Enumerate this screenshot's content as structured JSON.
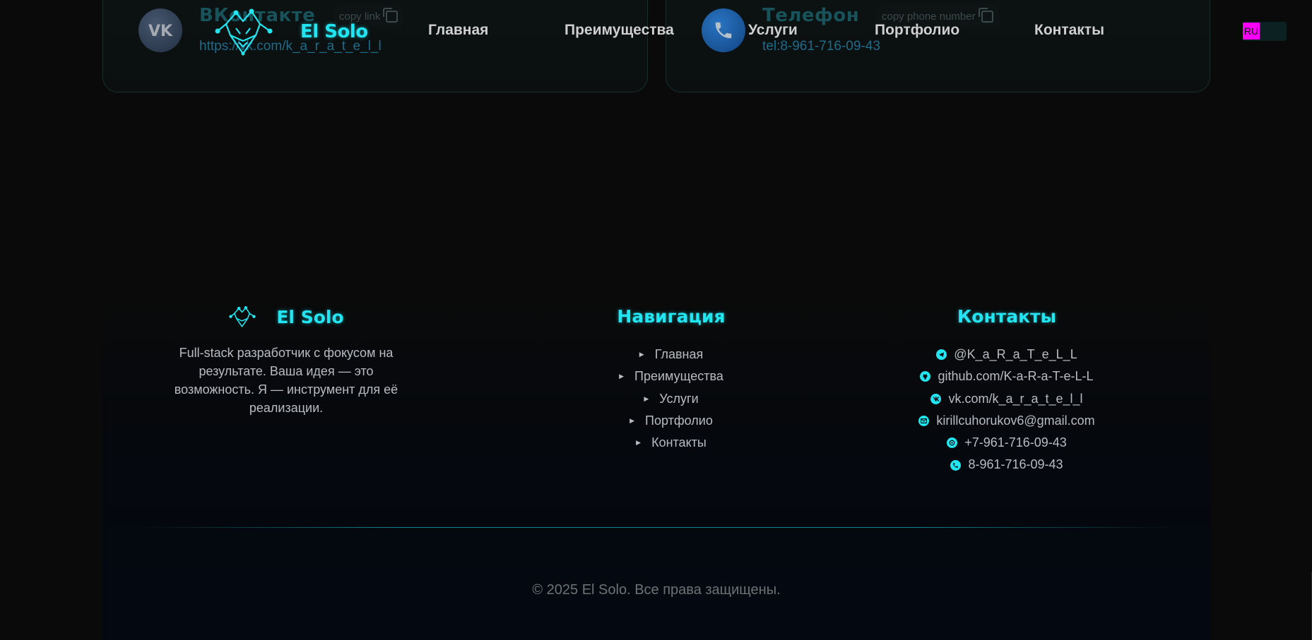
{
  "cards": [
    {
      "title": "ВКонтакте",
      "link": "https://vk.com/k_a_r_a_t_e_l_l",
      "copy_label": "copy link",
      "icon": "vk-icon"
    },
    {
      "title": "Телефон",
      "link": "tel:8-961-716-09-43",
      "copy_label": "copy phone number",
      "icon": "phone-icon"
    }
  ],
  "header": {
    "brand": "El Solo",
    "nav": [
      "Главная",
      "Преимущества",
      "Услуги",
      "Портфолио",
      "Контакты"
    ],
    "language": "RU"
  },
  "footer": {
    "brand": "El Solo",
    "description": "Full-stack разработчик с фокусом на результате. Ваша идея — это возможность. Я — инструмент для её реализации.",
    "nav_heading": "Навигация",
    "nav": [
      "Главная",
      "Преимущества",
      "Услуги",
      "Портфолио",
      "Контакты"
    ],
    "contacts_heading": "Контакты",
    "contacts": [
      {
        "icon": "telegram-icon",
        "text": "@K_a_R_a_T_e_L_L"
      },
      {
        "icon": "github-icon",
        "text": "github.com/K-a-R-a-T-e-L-L"
      },
      {
        "icon": "vk-icon",
        "text": "vk.com/k_a_r_a_t_e_l_l"
      },
      {
        "icon": "email-icon",
        "text": "kirillcuhorukov6@gmail.com"
      },
      {
        "icon": "whatsapp-icon",
        "text": "+7-961-716-09-43"
      },
      {
        "icon": "phone-icon",
        "text": "8-961-716-09-43"
      }
    ],
    "copyright": "© 2025 El Solo. Все права защищены."
  },
  "colors": {
    "accent": "#21e6f2",
    "background": "#0a0a0a",
    "language_flag": "#ff00ff"
  }
}
